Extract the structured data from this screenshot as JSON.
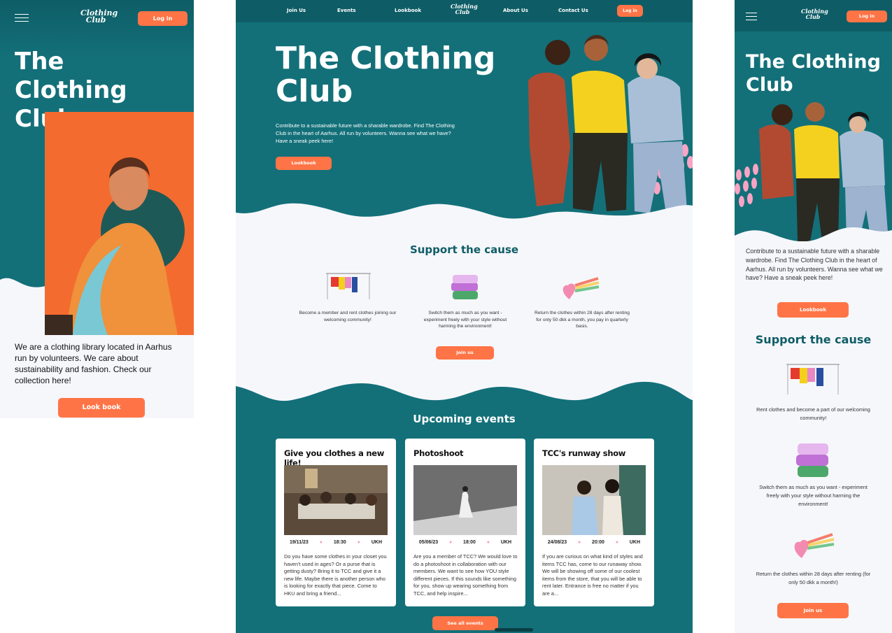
{
  "brand": {
    "logo_line1": "Clothing",
    "logo_line2": "Club"
  },
  "mobile_left": {
    "login_label": "Log in",
    "title": "The Clothing Club",
    "intro": "We are a clothing library located in Aarhus run by volunteers. We care about sustainability and fashion. Check our collection here!",
    "lookbook_label": "Look book"
  },
  "desktop": {
    "nav": {
      "items": [
        "Join Us",
        "Events",
        "Lookbook",
        "About Us",
        "Contact Us"
      ],
      "login_label": "Log in"
    },
    "hero": {
      "title": "The Clothing Club",
      "intro": "Contribute to a sustainable future with a sharable wardrobe. Find The Clothing Club in the heart of Aarhus. All run by volunteers. Wanna see what we have? Have a sneak peek here!",
      "lookbook_label": "Lookbook"
    },
    "cause": {
      "title": "Support the cause",
      "items": [
        "Become a member and rent clothes joining our welcoming community!",
        "Switch them as much as you want - experiment freely with your style without harming the environment!",
        "Return the clothes within 28 days after renting for only 50 dkk a month, you pay in quarterly basis."
      ],
      "join_label": "Join us"
    },
    "events": {
      "title": "Upcoming events",
      "cards": [
        {
          "title": "Give you clothes a new life!",
          "date": "19/11/23",
          "time": "18:30",
          "place": "UKH",
          "text": "Do you have some clothes in your closet you haven't used in ages? Or a purse that is getting dusty? Bring it to TCC and give it a new life. Maybe there is another person who is looking for exactly that piece. Come to HKU and bring a friend..."
        },
        {
          "title": "Photoshoot",
          "date": "05/06/23",
          "time": "18:00",
          "place": "UKH",
          "text": "Are you a member of TCC? We would love to do a photoshoot in collaboration with our members. We want to see how YOU style different pieces. If this sounds like something for you, show up wearing something from TCC, and help inspire..."
        },
        {
          "title": "TCC's runway show",
          "date": "24/08/23",
          "time": "20:00",
          "place": "UKH",
          "text": "If you are curious on what kind of styles and items TCC has, come to our runaway show. We will be showing off some of our coolest items from the store, that you will be able to rent later. Entrance is free no matter if you are a..."
        }
      ],
      "see_all_label": "See all events"
    }
  },
  "mobile_right": {
    "login_label": "Log in",
    "title": "The Clothing Club",
    "intro": "Contribute to a sustainable future with a sharable wardrobe. Find The Clothing Club in the heart of Aarhus. All run by volunteers. Wanna see what we have? Have a sneak peek here!",
    "lookbook_label": "Lookbook",
    "cause_title": "Support the cause",
    "items": [
      "Rent clothes and become a part of our welcoming community!",
      "Switch them as much as you want - experiment freely with your style without harming the environment!",
      "Return the clothes within 28 days after renting (for only 50 dkk a month!)"
    ],
    "join_label": "Join us"
  },
  "colors": {
    "teal": "#137079",
    "teal_dark": "#0e5d66",
    "accent": "#ff7446",
    "bg_light": "#f6f7fb"
  }
}
